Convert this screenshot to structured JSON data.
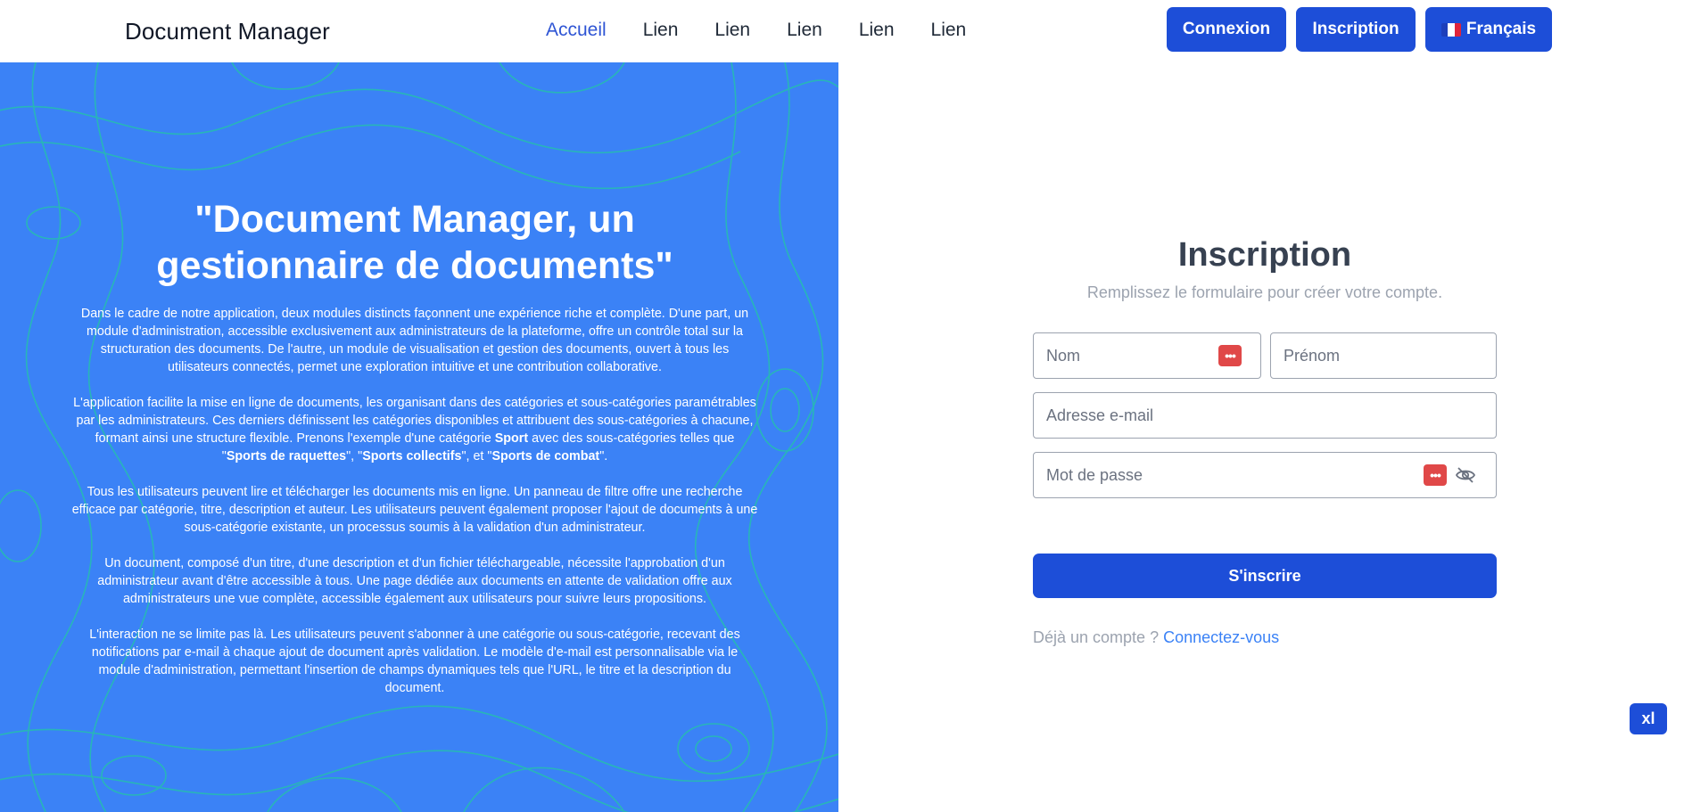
{
  "app": {
    "brand": "Document Manager"
  },
  "nav": {
    "links": [
      "Accueil",
      "Lien",
      "Lien",
      "Lien",
      "Lien",
      "Lien"
    ],
    "login_label": "Connexion",
    "register_label": "Inscription",
    "language_label": "Français",
    "language_flag": [
      "#1d3fbb",
      "#ffffff",
      "#e1243a"
    ]
  },
  "hero": {
    "title": "\"Document Manager, un gestionnaire de documents\"",
    "p1": "Dans le cadre de notre application, deux modules distincts façonnent une expérience riche et complète. D'une part, un module d'administration, accessible exclusivement aux administrateurs de la plateforme, offre un contrôle total sur la structuration des documents. De l'autre, un module de visualisation et gestion des documents, ouvert à tous les utilisateurs connectés, permet une exploration intuitive et une contribution collaborative.",
    "p2_a": "L'application facilite la mise en ligne de documents, les organisant dans des catégories et sous-catégories paramétrables par les administrateurs. Ces derniers définissent les catégories disponibles et attribuent des sous-catégories à chacune, formant ainsi une structure flexible. Prenons l'exemple d'une catégorie ",
    "p2_sport": "Sport",
    "p2_b": " avec des sous-catégories telles que \"",
    "p2_raquettes": "Sports de raquettes",
    "p2_c": "\", \"",
    "p2_collectifs": "Sports collectifs",
    "p2_d": "\", et \"",
    "p2_combat": "Sports de combat",
    "p2_e": "\".",
    "p3": "Tous les utilisateurs peuvent lire et télécharger les documents mis en ligne. Un panneau de filtre offre une recherche efficace par catégorie, titre, description et auteur. Les utilisateurs peuvent également proposer l'ajout de documents à une sous-catégorie existante, un processus soumis à la validation d'un administrateur.",
    "p4": "Un document, composé d'un titre, d'une description et d'un fichier téléchargeable, nécessite l'approbation d'un administrateur avant d'être accessible à tous. Une page dédiée aux documents en attente de validation offre aux administrateurs une vue complète, accessible également aux utilisateurs pour suivre leurs propositions.",
    "p5": "L'interaction ne se limite pas là. Les utilisateurs peuvent s'abonner à une catégorie ou sous-catégorie, recevant des notifications par e-mail à chaque ajout de document après validation. Le modèle d'e-mail est personnalisable via le module d'administration, permettant l'insertion de champs dynamiques tels que l'URL, le titre et la description du document."
  },
  "form": {
    "title": "Inscription",
    "subtitle": "Remplissez le formulaire pour créer votre compte.",
    "nom_placeholder": "Nom",
    "prenom_placeholder": "Prénom",
    "email_placeholder": "Adresse e-mail",
    "password_placeholder": "Mot de passe",
    "submit_label": "S'inscrire",
    "have_account": "Déjà un compte ?",
    "login_link": "Connectez-vous"
  },
  "badge": {
    "breakpoint": "xl"
  },
  "colors": {
    "primary": "#1d4ed8",
    "hero_bg": "#3b82f6",
    "topo_line": "#22c7a4",
    "password_manager": "#e04848"
  }
}
